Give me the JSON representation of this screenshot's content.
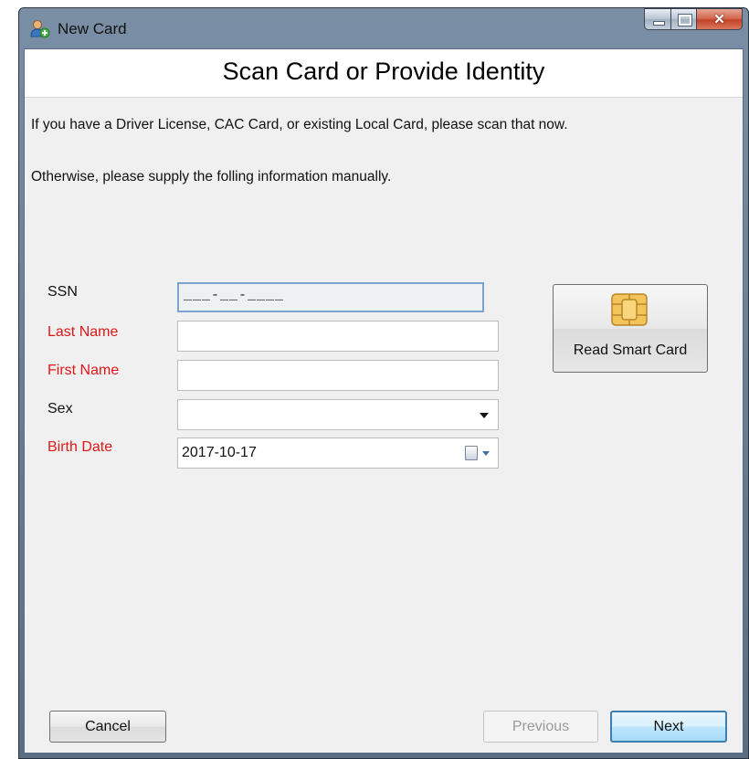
{
  "window": {
    "title": "New Card",
    "icon": "user-add-icon"
  },
  "header": {
    "title": "Scan Card or Provide Identity"
  },
  "instructions": {
    "line1": "If you have a Driver License, CAC Card, or existing Local Card, please scan that now.",
    "line2": "Otherwise, please supply the folling information manually."
  },
  "form": {
    "ssn": {
      "label": "SSN",
      "value": "___-__-____",
      "required": false
    },
    "last_name": {
      "label": "Last Name",
      "value": "",
      "required": true
    },
    "first_name": {
      "label": "First Name",
      "value": "",
      "required": true
    },
    "sex": {
      "label": "Sex",
      "value": "",
      "required": false
    },
    "birth_date": {
      "label": "Birth Date",
      "value": "2017-10-17",
      "required": true
    }
  },
  "smart_card": {
    "label": "Read Smart Card",
    "icon": "smart-card-chip-icon"
  },
  "footer": {
    "cancel_label": "Cancel",
    "previous_label": "Previous",
    "next_label": "Next"
  },
  "colors": {
    "required_label": "#e01717",
    "focus_border": "#7da2ce",
    "next_border": "#3c7fb1"
  }
}
